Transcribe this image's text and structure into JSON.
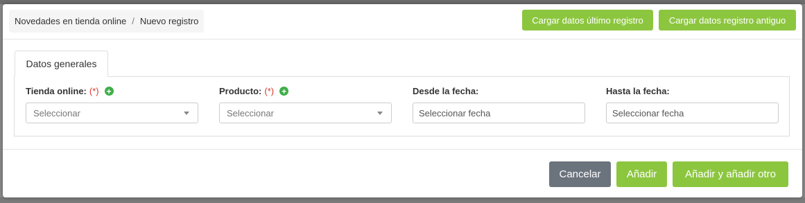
{
  "breadcrumb": {
    "parent": "Novedades en tienda online",
    "separator": "/",
    "current": "Nuevo registro"
  },
  "header": {
    "load_last_label": "Cargar datos último registro",
    "load_old_label": "Cargar datos registro antiguo"
  },
  "tabs": [
    {
      "label": "Datos generales",
      "active": true
    }
  ],
  "form": {
    "tienda": {
      "label": "Tienda online:",
      "required": "(*)",
      "placeholder": "Seleccionar"
    },
    "producto": {
      "label": "Producto:",
      "required": "(*)",
      "placeholder": "Seleccionar"
    },
    "desde": {
      "label": "Desde la fecha:",
      "placeholder": "Seleccionar fecha"
    },
    "hasta": {
      "label": "Hasta la fecha:",
      "placeholder": "Seleccionar fecha"
    }
  },
  "footer": {
    "cancel_label": "Cancelar",
    "add_label": "Añadir",
    "add_more_label": "Añadir y añadir otro"
  },
  "icons": {
    "add_icon": "plus-circle",
    "dropdown_icon": "caret-down"
  },
  "colors": {
    "primary_button": "#8cc63f",
    "secondary_button": "#6b737d",
    "required_marker": "#d9372a",
    "add_icon": "#3fae49"
  }
}
